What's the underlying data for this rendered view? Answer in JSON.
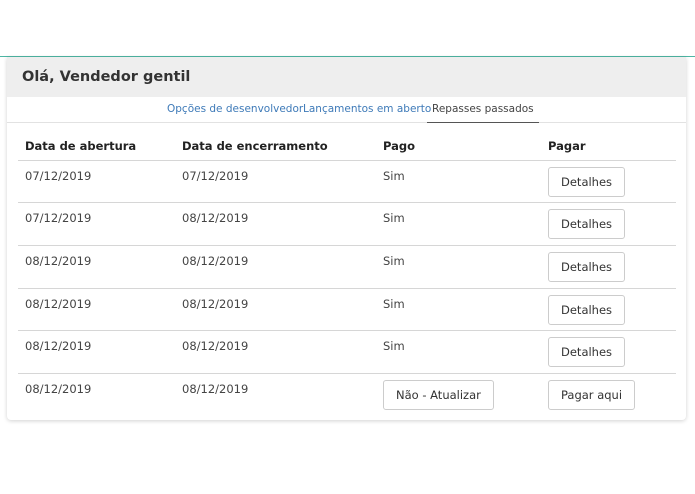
{
  "header": {
    "greeting": "Olá, Vendedor gentil"
  },
  "tabs": [
    {
      "label": "Opções de desenvolvedor",
      "active": false
    },
    {
      "label": "Lançamentos em aberto",
      "active": false
    },
    {
      "label": "Repasses passados",
      "active": true
    }
  ],
  "table": {
    "columns": [
      "Data de abertura",
      "Data de encerramento",
      "Pago",
      "Pagar"
    ],
    "rows": [
      {
        "open": "07/12/2019",
        "close": "07/12/2019",
        "paid": "Sim",
        "action": "Detalhes"
      },
      {
        "open": "07/12/2019",
        "close": "08/12/2019",
        "paid": "Sim",
        "action": "Detalhes"
      },
      {
        "open": "08/12/2019",
        "close": "08/12/2019",
        "paid": "Sim",
        "action": "Detalhes"
      },
      {
        "open": "08/12/2019",
        "close": "08/12/2019",
        "paid": "Sim",
        "action": "Detalhes"
      },
      {
        "open": "08/12/2019",
        "close": "08/12/2019",
        "paid": "Sim",
        "action": "Detalhes"
      },
      {
        "open": "08/12/2019",
        "close": "08/12/2019",
        "paid": "Não - Atualizar",
        "action": "Pagar aqui"
      }
    ]
  }
}
